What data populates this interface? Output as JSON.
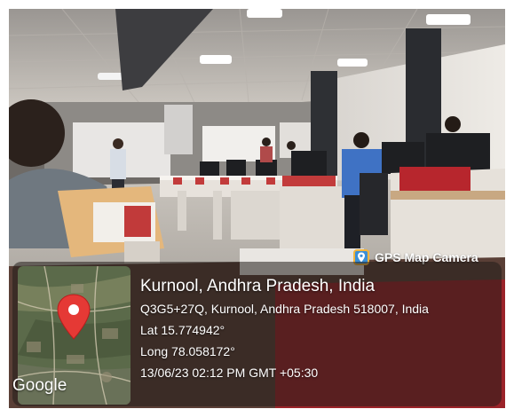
{
  "badge": {
    "label": "GPS Map Camera",
    "icon": "map-pin-app-icon"
  },
  "map": {
    "attribution": "Google",
    "pin_color": "#e53935"
  },
  "location": {
    "title": "Kurnool, Andhra Pradesh, India",
    "address": "Q3G5+27Q, Kurnool, Andhra Pradesh 518007, India",
    "latitude": "Lat 15.774942°",
    "longitude": "Long 78.058172°",
    "datetime": "13/06/23 02:12 PM GMT +05:30"
  }
}
